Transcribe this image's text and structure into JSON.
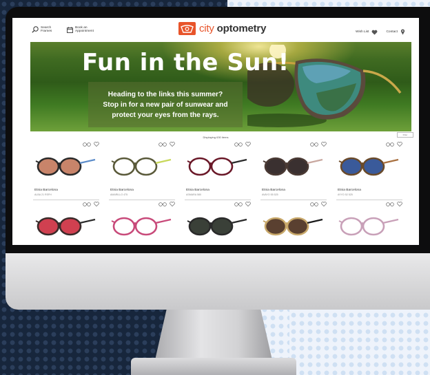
{
  "header": {
    "search_label": "Search Frames",
    "appointment_label": "Book an Appointment",
    "logo_word1": "city",
    "logo_word2": "optometry",
    "wishlist_label": "Wish List",
    "contact_label": "Contact"
  },
  "banner": {
    "title": "Fun in the Sun!",
    "line1": "Heading to the links this summer?",
    "line2": "Stop in for a new pair of sunwear and",
    "line3": "protect your eyes from the rays."
  },
  "results": {
    "count_text": "Displaying 630 items",
    "filter_label": "Filter"
  },
  "products": [
    {
      "brand": "Etnia Barcelona",
      "model": "ALBA 21 RSFH",
      "frame": "#2a2a2a",
      "lens": "#c8846a",
      "temple": "#5c8cc9"
    },
    {
      "brand": "Etnia Barcelona",
      "model": "AMARILLO 475",
      "frame": "#5a5a3a",
      "lens": "#ffffff",
      "temple": "#c8d85a"
    },
    {
      "brand": "Etnia Barcelona",
      "model": "ASMARA 580",
      "frame": "#6a1828",
      "lens": "#ffffff",
      "temple": "#2a2a2a"
    },
    {
      "brand": "Etnia Barcelona",
      "model": "AVAYO 55 525",
      "frame": "#4a3a34",
      "lens": "#3a3030",
      "temple": "#c9a8a0"
    },
    {
      "brand": "Etnia Barcelona",
      "model": "AYYO 52 525",
      "frame": "#6a4a2a",
      "lens": "#3a5a9a",
      "temple": "#a87040"
    },
    {
      "brand": "",
      "model": "",
      "frame": "#3a2a2a",
      "lens": "#d04050",
      "temple": "#2a2a2a"
    },
    {
      "brand": "",
      "model": "",
      "frame": "#c84a7a",
      "lens": "#ffffff",
      "temple": "#c84a7a"
    },
    {
      "brand": "",
      "model": "",
      "frame": "#2a2a2a",
      "lens": "#3a4038",
      "temple": "#2a2a2a"
    },
    {
      "brand": "",
      "model": "",
      "frame": "#c8a86a",
      "lens": "#5a4030",
      "temple": "#1a1a1a"
    },
    {
      "brand": "",
      "model": "",
      "frame": "#c8a0b8",
      "lens": "#ffffff",
      "temple": "#c8a0b8"
    }
  ],
  "colors": {
    "brand_orange": "#e8542a",
    "banner_green": "#3f6a21"
  },
  "icons": [
    "search-icon",
    "calendar-icon",
    "heart-icon",
    "location-pin-icon",
    "glasses-logo-icon",
    "wishlist-heart-icon",
    "try-on-glasses-icon"
  ]
}
